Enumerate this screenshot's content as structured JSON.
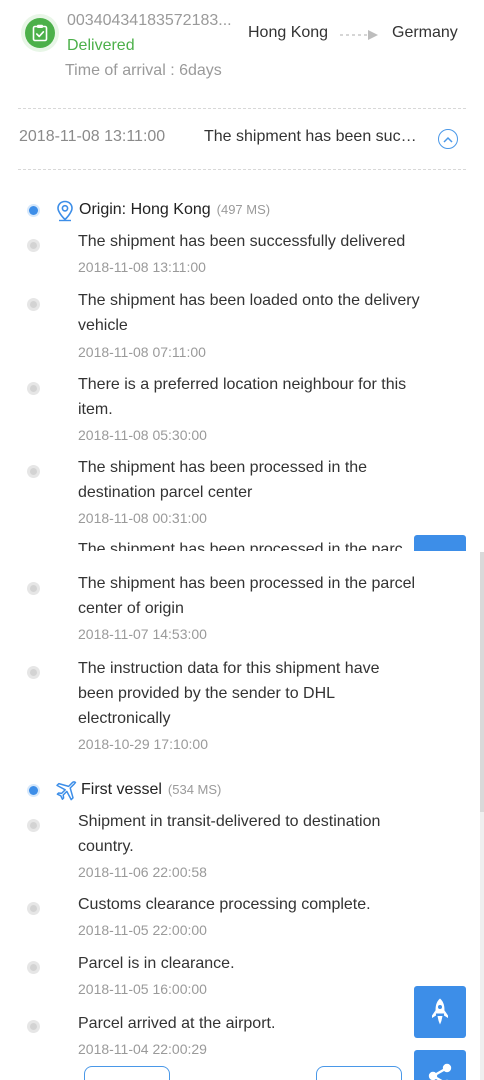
{
  "header": {
    "tracking_number": "00340434183572183...",
    "status": "Delivered",
    "arrival_label": "Time of arrival : 6days",
    "origin": "Hong Kong",
    "destination": "Germany"
  },
  "summary": {
    "time": "2018-11-08 13:11:00",
    "text": "The shipment has been successfully delivered"
  },
  "segments": [
    {
      "title": "Origin: Hong Kong",
      "meta": "(497 MS)",
      "icon": "location-pin-icon",
      "events": [
        {
          "text": "The shipment has been successfully delivered",
          "time": "2018-11-08 13:11:00"
        },
        {
          "text": "The shipment has been loaded onto the delivery vehicle",
          "time": "2018-11-08 07:11:00"
        },
        {
          "text": "There is a preferred location neighbour for this item.",
          "time": "2018-11-08 05:30:00"
        },
        {
          "text": "The shipment has been processed in the destination parcel center",
          "time": "2018-11-08 00:31:00"
        },
        {
          "text": "The shipment has been processed in the parcel center of origin",
          "time": "2018-11-07 14:53:00"
        },
        {
          "text": "The instruction data for this shipment have been provided by the sender to DHL electronically",
          "time": "2018-10-29 17:10:00"
        }
      ]
    },
    {
      "title": "First vessel",
      "meta": "(534 MS)",
      "icon": "airplane-icon",
      "events": [
        {
          "text": "Shipment in transit-delivered to destination country.",
          "time": "2018-11-06 22:00:58"
        },
        {
          "text": "Customs clearance processing complete.",
          "time": "2018-11-05 22:00:00"
        },
        {
          "text": "Parcel is in clearance.",
          "time": "2018-11-05 16:00:00"
        },
        {
          "text": "Parcel arrived at the airport.",
          "time": "2018-11-04 22:00:29"
        }
      ]
    }
  ],
  "ghost_row_text": "The shipment has been processed in the parc",
  "colors": {
    "accent": "#3d8ee8",
    "success": "#4cb04a",
    "muted": "#9a9a9a"
  },
  "fabs": [
    "rocket-icon",
    "share-icon"
  ]
}
